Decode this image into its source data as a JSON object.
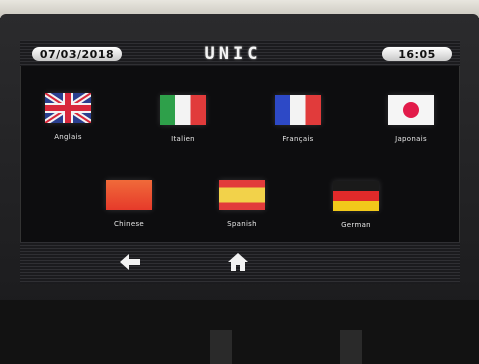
{
  "header": {
    "date": "07/03/2018",
    "logo": "UNIC",
    "time": "16:05"
  },
  "languages": [
    {
      "label": "Anglais",
      "flag": "uk-flag"
    },
    {
      "label": "Italien",
      "flag": "italy-flag"
    },
    {
      "label": "Français",
      "flag": "france-flag"
    },
    {
      "label": "Japonais",
      "flag": "japan-flag"
    },
    {
      "label": "Chinese",
      "flag": "china-flag"
    },
    {
      "label": "Spanish",
      "flag": "spain-flag"
    },
    {
      "label": "German",
      "flag": "germany-flag"
    }
  ],
  "nav": {
    "back_icon": "back-arrow-icon",
    "home_icon": "home-icon"
  },
  "colors": {
    "screen_bg": "#0d0d0f",
    "label_text": "#e6e6e6",
    "header_pill": "#ffffff"
  }
}
